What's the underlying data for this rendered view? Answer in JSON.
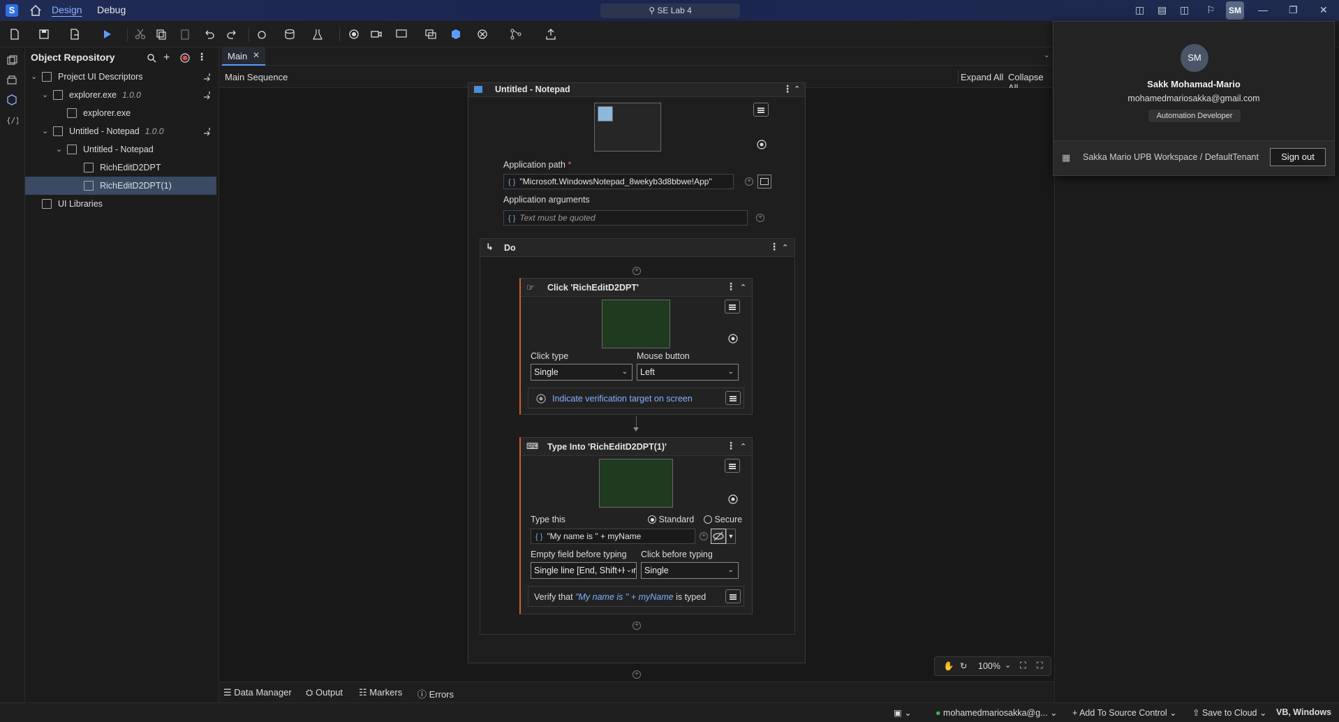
{
  "titlebar": {
    "logo": "S",
    "tabs": [
      "Design",
      "Debug"
    ],
    "search": "SE Lab 4",
    "avatar": "SM"
  },
  "repo": {
    "title": "Object Repository",
    "items": [
      {
        "label": "Project UI Descriptors"
      },
      {
        "label": "explorer.exe",
        "version": "1.0.0"
      },
      {
        "label": "explorer.exe"
      },
      {
        "label": "Untitled - Notepad",
        "version": "1.0.0"
      },
      {
        "label": "Untitled - Notepad"
      },
      {
        "label": "RichEditD2DPT"
      },
      {
        "label": "RichEditD2DPT(1)"
      },
      {
        "label": "UI Libraries"
      }
    ]
  },
  "doc": {
    "tab": "Main",
    "sequence": "Main Sequence",
    "expand_all": "Expand All",
    "collapse_all": "Collapse All"
  },
  "use_app": {
    "title": "Untitled - Notepad",
    "app_path_label": "Application path",
    "required_mark": "*",
    "app_path_value": "\"Microsoft.WindowsNotepad_8wekyb3d8bbwe!App\"",
    "app_args_label": "Application arguments",
    "app_args_placeholder": "Text must be quoted"
  },
  "do_block": {
    "title": "Do"
  },
  "click": {
    "title": "Click 'RichEditD2DPT'",
    "click_type_label": "Click type",
    "click_type_value": "Single",
    "mouse_button_label": "Mouse button",
    "mouse_button_value": "Left",
    "verify_link": "Indicate verification target on screen"
  },
  "type_into": {
    "title": "Type Into 'RichEditD2DPT(1)'",
    "type_this_label": "Type this",
    "standard_label": "Standard",
    "secure_label": "Secure",
    "type_value": "\"My name is \" + myName",
    "empty_field_label": "Empty field before typing",
    "empty_field_value": "Single line [End, Shift+Home, Del]",
    "click_before_label": "Click before typing",
    "click_before_value": "Single",
    "verify_prefix": "Verify that",
    "verify_expr": "\"My name is \" + myName",
    "verify_suffix": "is typed"
  },
  "zoom": {
    "level": "100%"
  },
  "bottom_tabs": [
    "Data Manager",
    "Output",
    "Markers",
    "Errors"
  ],
  "profile": {
    "initials": "SM",
    "name": "Sakk Mohamad-Mario",
    "email": "mohamedmariosakka@gmail.com",
    "role": "Automation Developer",
    "workspace": "Sakka Mario UPB Workspace / DefaultTenant",
    "signout": "Sign out"
  },
  "status": {
    "account": "mohamedmariosakka@g...",
    "source_control": "Add To Source Control",
    "save_cloud": "Save to Cloud",
    "lang": "VB, Windows"
  },
  "colors": {
    "accent": "#5b9cff",
    "link": "#7fb2ff",
    "required": "#e06c6c",
    "thumb_green": "#1f3a1f"
  }
}
